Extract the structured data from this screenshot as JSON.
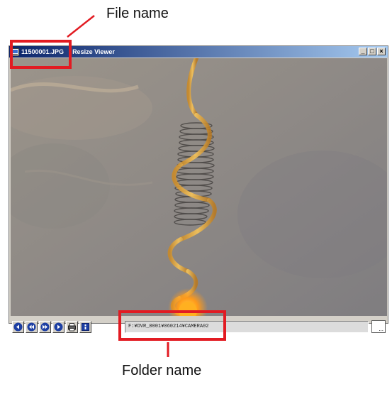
{
  "annotations": {
    "file_callout": "File name",
    "folder_callout": "Folder name"
  },
  "window": {
    "filename": "11500001.JPG",
    "app_name": "Resize Viewer",
    "controls": {
      "minimize": "_",
      "maximize": "□",
      "close": "×"
    }
  },
  "toolbar": {
    "buttons": [
      {
        "name": "first-image",
        "icon": "skip-back-icon"
      },
      {
        "name": "previous-image",
        "icon": "previous-icon"
      },
      {
        "name": "next-image",
        "icon": "next-icon"
      },
      {
        "name": "last-image",
        "icon": "skip-forward-icon"
      },
      {
        "name": "print",
        "icon": "printer-icon"
      },
      {
        "name": "info",
        "icon": "info-icon"
      }
    ],
    "folder_path": "F:¥DVR_0001¥060214¥CAMERA02",
    "browse_label": "..."
  },
  "colors": {
    "callout_red": "#e21b22",
    "title_bar_start": "#0a246a",
    "title_bar_end": "#a6caf0",
    "nav_button_blue": "#1d3fa3",
    "window_face": "#d4d0c8"
  }
}
